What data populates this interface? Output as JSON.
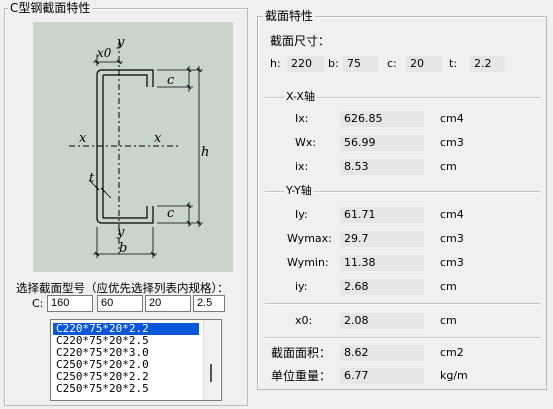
{
  "left_group": {
    "title": "C型钢截面特性",
    "select_label": "选择截面型号（应优先选择列表内规格）：",
    "c_label": "C:",
    "inputs": [
      "160",
      "60",
      "20",
      "2.5"
    ],
    "list_items": [
      "C220*75*20*2.2",
      "C220*75*20*2.5",
      "C220*75*20*3.0",
      "C250*75*20*2.0",
      "C250*75*20*2.2",
      "C250*75*20*2.5"
    ],
    "selected_index": 0,
    "diagram": {
      "y": "y",
      "x0": "x0",
      "c": "c",
      "x": "x",
      "h": "h",
      "t": "t",
      "b": "b"
    }
  },
  "right_group": {
    "title": "截面特性",
    "dims_label": "截面尺寸：",
    "dims": [
      {
        "label": "h:",
        "value": "220"
      },
      {
        "label": "b:",
        "value": "75"
      },
      {
        "label": "c:",
        "value": "20"
      },
      {
        "label": "t:",
        "value": "2.2"
      }
    ],
    "xx_title": "X-X轴",
    "xx": [
      {
        "label": "Ix:",
        "value": "626.85",
        "unit": "cm4"
      },
      {
        "label": "Wx:",
        "value": "56.99",
        "unit": "cm3"
      },
      {
        "label": "ix:",
        "value": "8.53",
        "unit": "cm"
      }
    ],
    "yy_title": "Y-Y轴",
    "yy": [
      {
        "label": "Iy:",
        "value": "61.71",
        "unit": "cm4"
      },
      {
        "label": "Wymax:",
        "value": "29.7",
        "unit": "cm3"
      },
      {
        "label": "Wymin:",
        "value": "11.38",
        "unit": "cm3"
      },
      {
        "label": "iy:",
        "value": "2.68",
        "unit": "cm"
      }
    ],
    "x0": {
      "label": "x0:",
      "value": "2.08",
      "unit": "cm"
    },
    "area": {
      "label": "截面面积：",
      "value": "8.62",
      "unit": "cm2"
    },
    "weight": {
      "label": "单位重量：",
      "value": "6.77",
      "unit": "kg/m"
    }
  }
}
